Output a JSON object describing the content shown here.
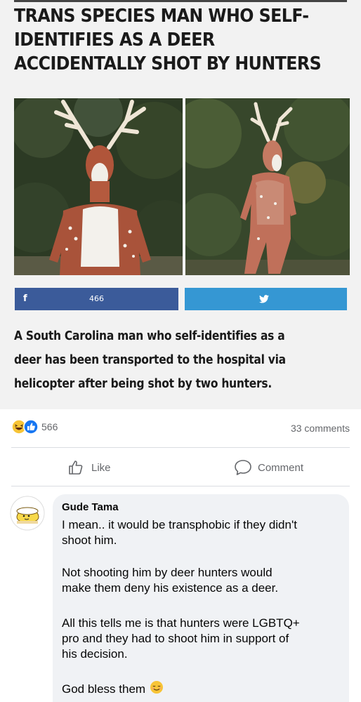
{
  "article": {
    "headline_lines": [
      "TRANS SPECIES MAN WHO SELF-",
      "IDENTIFIES AS A DEER",
      "ACCIDENTALLY SHOT BY HUNTERS"
    ],
    "share_facebook_count": "466",
    "lede_lines": [
      "A South Carolina man who self-identifies as a",
      "deer has been transported to the hospital via",
      "helicopter after being shot by two hunters."
    ],
    "colors": {
      "facebook": "#3b5b9a",
      "twitter": "#3597d3"
    }
  },
  "post": {
    "reaction_count": "566",
    "comments_count": "33 comments",
    "like_label": "Like",
    "comment_label": "Comment",
    "icons": {
      "haha": "haha-reaction-icon",
      "like": "like-reaction-icon",
      "like_button": "thumbs-up-icon",
      "comment_button": "speech-bubble-icon",
      "emoji": "relieved-face-emoji-icon"
    }
  },
  "comment": {
    "author": "Gude Tama",
    "paragraph1": [
      "I mean.. it would be transphobic if they didn't",
      "shoot him."
    ],
    "paragraph2": [
      "Not shooting him by deer hunters would",
      "make them deny his existence as a deer."
    ],
    "paragraph3": [
      "All this tells me is that hunters were LGBTQ+",
      "pro and they had to shoot him in support of",
      "his decision."
    ],
    "paragraph4": "God bless them"
  }
}
